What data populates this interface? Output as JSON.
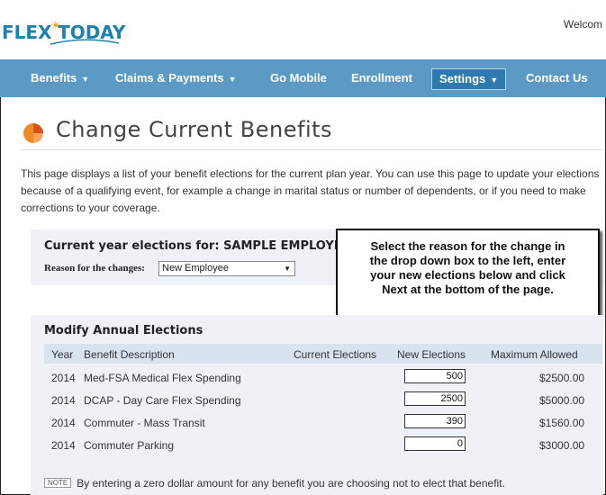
{
  "header": {
    "logo_part1": "FLEX",
    "logo_part2": "TODAY",
    "welcome": "Welcom"
  },
  "nav": {
    "items": [
      {
        "label": "Benefits",
        "dropdown": true
      },
      {
        "label": "Claims & Payments",
        "dropdown": true
      },
      {
        "label": "Go Mobile",
        "dropdown": false
      },
      {
        "label": "Enrollment",
        "dropdown": false
      },
      {
        "label": "Settings",
        "dropdown": true,
        "active": true
      },
      {
        "label": "Contact Us",
        "dropdown": false
      }
    ],
    "caret": "▼"
  },
  "page": {
    "title": "Change Current Benefits",
    "description": "This page displays a list of your benefit elections for the current plan year. You can use this page to update your elections because of a qualifying event, for example a change in marital status or number of dependents, or if you need to make corrections to your coverage."
  },
  "current_year": {
    "title": "Current year elections for: SAMPLE EMPLOYEE",
    "reason_label": "Reason for the changes:",
    "reason_value": "New Employee"
  },
  "callout": {
    "line1": "Select the reason for the change in",
    "line2": "the drop down box to the left, enter",
    "line3": "your new elections below and click",
    "line4": "Next at the bottom of the page."
  },
  "annual": {
    "title": "Modify Annual Elections",
    "columns": [
      "Year",
      "Benefit Description",
      "Current Elections",
      "New Elections",
      "Maximum Allowed"
    ],
    "rows": [
      {
        "year": "2014",
        "description": "Med-FSA Medical Flex Spending",
        "current": "",
        "new": "500",
        "max": "$2500.00"
      },
      {
        "year": "2014",
        "description": "DCAP - Day Care Flex Spending",
        "current": "",
        "new": "2500",
        "max": "$5000.00"
      },
      {
        "year": "2014",
        "description": "Commuter - Mass Transit",
        "current": "",
        "new": "390",
        "max": "$1560.00"
      },
      {
        "year": "2014",
        "description": "Commuter Parking",
        "current": "",
        "new": "0",
        "max": "$3000.00"
      }
    ]
  },
  "note": {
    "badge": "NOTE",
    "text": "By entering a zero dollar amount for any benefit you are choosing not to elect that benefit."
  },
  "colors": {
    "nav_bg": "#5a9ac4",
    "nav_active": "#2e79ad",
    "panel_bg": "#eef1f6",
    "table_header_bg": "#d9e3ee",
    "logo_blue": "#1f7fb0",
    "logo_orange": "#f2a41c"
  }
}
